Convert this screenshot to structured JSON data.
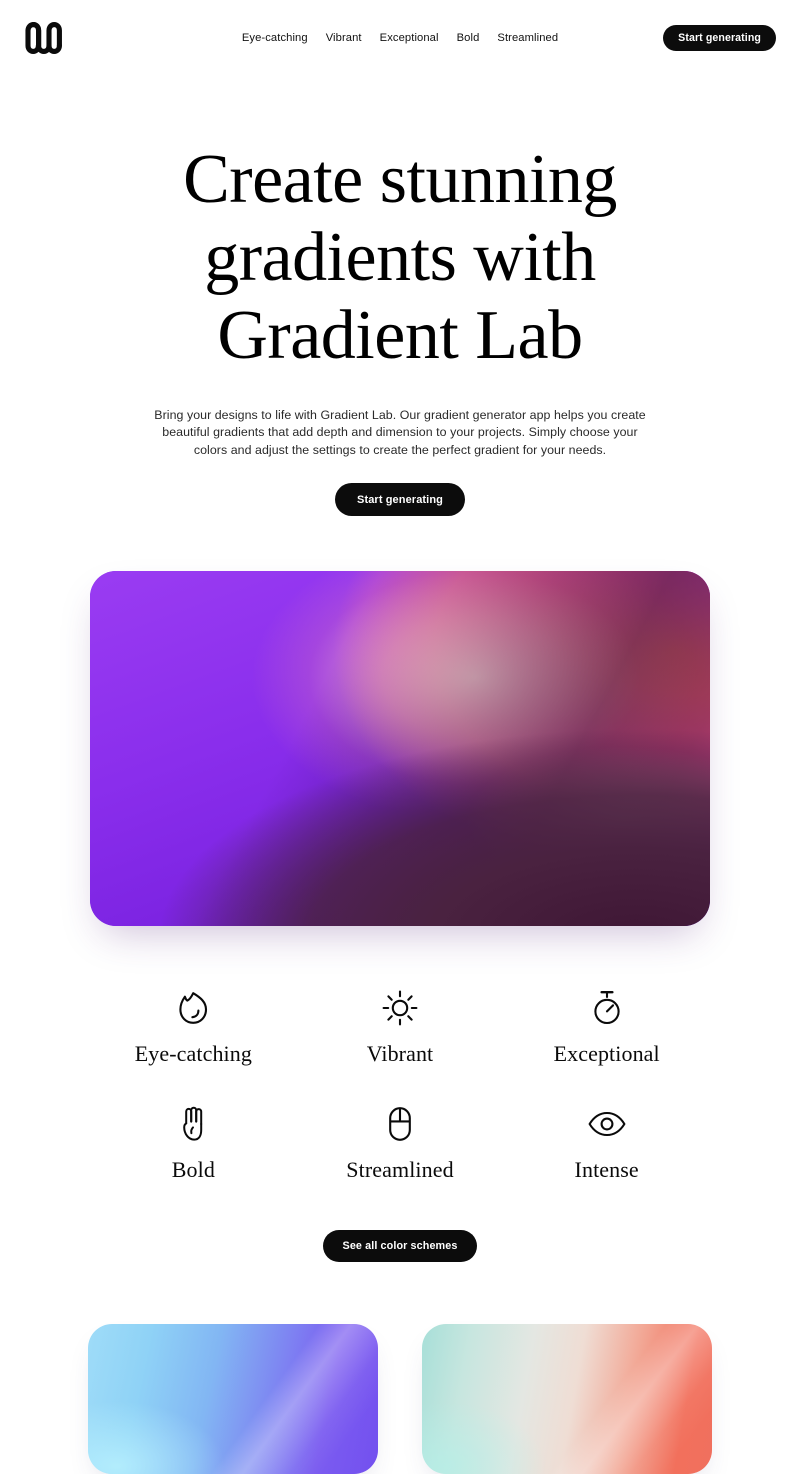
{
  "brand": {
    "logo_icon": "wave-w-logo-icon",
    "name": "Gradient Lab"
  },
  "header": {
    "nav_items": [
      {
        "label": "Eye-catching"
      },
      {
        "label": "Vibrant"
      },
      {
        "label": "Exceptional"
      },
      {
        "label": "Bold"
      },
      {
        "label": "Streamlined"
      }
    ],
    "cta_label": "Start generating"
  },
  "hero": {
    "title_lines": [
      "Create stunning",
      "gradients with",
      "Gradient Lab"
    ],
    "title": "Create stunning gradients with Gradient Lab",
    "description": "Bring your designs to life with Gradient Lab. Our gradient generator app helps you create beautiful gradients that add depth and dimension to your projects. Simply choose your colors and adjust the settings to create the perfect gradient for your needs.",
    "cta_label": "Start generating"
  },
  "showcase": {
    "alt": "purple pink coral gradient preview",
    "colors": {
      "violet": "#8A2EEC",
      "magenta": "#C846BE",
      "pink": "#EE5393",
      "coral": "#FF6B5E",
      "pale_pink": "#FFD6D6",
      "dark_plum": "#4A2240"
    }
  },
  "features": [
    {
      "label": "Eye-catching",
      "icon": "flame-icon"
    },
    {
      "label": "Vibrant",
      "icon": "sun-icon"
    },
    {
      "label": "Exceptional",
      "icon": "stopwatch-icon"
    },
    {
      "label": "Bold",
      "icon": "hand-icon"
    },
    {
      "label": "Streamlined",
      "icon": "mouse-icon"
    },
    {
      "label": "Intense",
      "icon": "eye-icon"
    }
  ],
  "schemes": {
    "cta_label": "See all color schemes"
  },
  "swatch_cards": [
    {
      "name": "blue-violet-swatch",
      "colors": {
        "start": "#9FDCF8",
        "end": "#7350EF"
      }
    },
    {
      "name": "teal-coral-swatch",
      "colors": {
        "start": "#A7DFD8",
        "end": "#F0705E"
      }
    }
  ]
}
